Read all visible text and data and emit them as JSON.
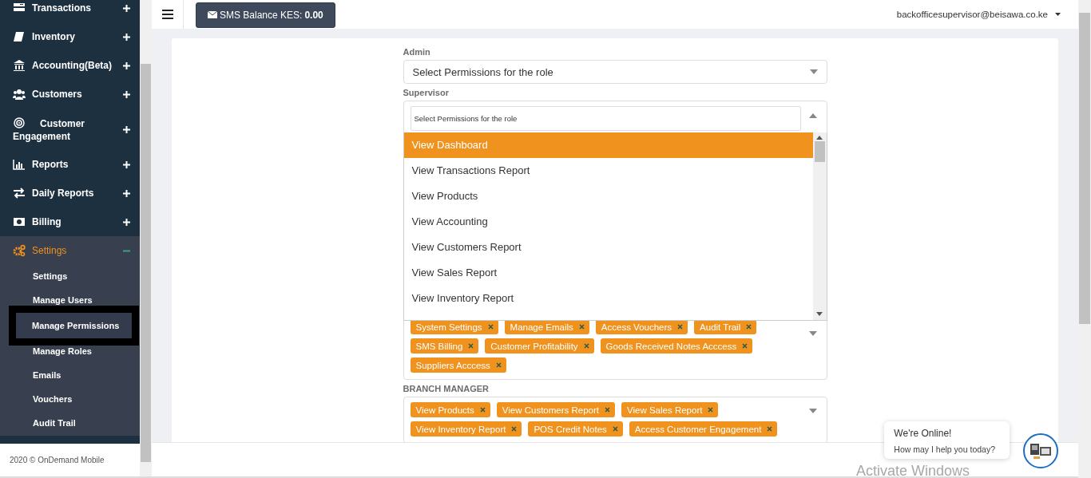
{
  "sidebar": {
    "items": [
      {
        "label": "Transactions",
        "expanded": false
      },
      {
        "label": "Inventory",
        "expanded": false
      },
      {
        "label": "Accounting(Beta)",
        "expanded": false
      },
      {
        "label": "Customers",
        "expanded": false
      },
      {
        "label": "Customer Engagement",
        "expanded": false
      },
      {
        "label": "Reports",
        "expanded": false
      },
      {
        "label": "Daily Reports",
        "expanded": false
      },
      {
        "label": "Billing",
        "expanded": false
      },
      {
        "label": "Settings",
        "expanded": true,
        "children": [
          {
            "label": "Settings",
            "selected": false
          },
          {
            "label": "Manage Users",
            "selected": false
          },
          {
            "label": "Manage Permissions",
            "selected": true
          },
          {
            "label": "Manage Roles",
            "selected": false
          },
          {
            "label": "Emails",
            "selected": false
          },
          {
            "label": "Vouchers",
            "selected": false
          },
          {
            "label": "Audit Trail",
            "selected": false
          }
        ]
      }
    ],
    "footer": "2020 © OnDemand Mobile"
  },
  "top_bar": {
    "sms_balance": {
      "label": "SMS Balance KES:",
      "amount": "0.00"
    },
    "user_menu": "backofficesupervisor@beisawa.co.ke"
  },
  "roles": [
    {
      "label": "Admin",
      "kind": "select",
      "placeholder": "Select Permissions for the role"
    },
    {
      "label": "Supervisor",
      "kind": "multiselect",
      "open": true,
      "search_placeholder": "Select Permissions for the role",
      "options": [
        {
          "label": "View Dashboard",
          "selected": true
        },
        {
          "label": "View Transactions Report",
          "selected": false
        },
        {
          "label": "View Products",
          "selected": false
        },
        {
          "label": "View Accounting",
          "selected": false
        },
        {
          "label": "View Customers Report",
          "selected": false
        },
        {
          "label": "View Sales Report",
          "selected": false
        },
        {
          "label": "View Inventory Report",
          "selected": false
        }
      ],
      "tags": [
        "System Settings",
        "Manage Emails",
        "Access Vouchers",
        "Audit Trail",
        "SMS Billing",
        "Customer Profitability",
        "Goods Received Notes Acccess",
        "Suppliers Acccess"
      ]
    },
    {
      "label": "BRANCH MANAGER",
      "kind": "multiselect",
      "open": false,
      "tags": [
        "View Products",
        "View Customers Report",
        "View Sales Report",
        "View Inventory Report",
        "POS Credit Notes",
        "Access Customer Engagement"
      ]
    }
  ],
  "chat": {
    "title": "We're Online!",
    "message": "How may I help you today?"
  },
  "system_notice": "Activate Windows"
}
